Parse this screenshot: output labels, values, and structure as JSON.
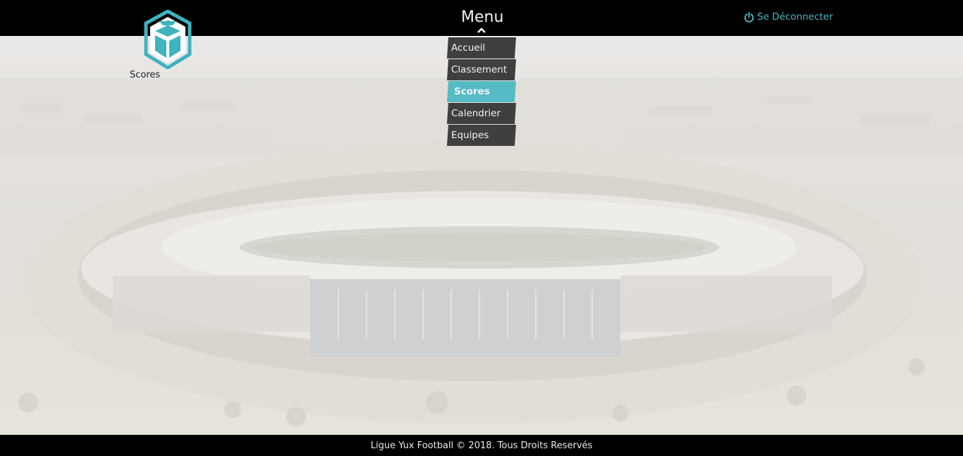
{
  "header": {
    "logo_icon": "cube-logo-icon",
    "logo_caption": "Scores",
    "menu_title": "Menu",
    "menu_caret_icon": "chevron-up-icon",
    "logout_icon": "power-icon",
    "logout_label": "Se Déconnecter"
  },
  "menu": {
    "items": [
      {
        "label": "Accueil",
        "active": false
      },
      {
        "label": "Classement",
        "active": false
      },
      {
        "label": "Scores",
        "active": true
      },
      {
        "label": "Calendrier",
        "active": false
      },
      {
        "label": "Equipes",
        "active": false
      }
    ]
  },
  "footer": {
    "text": "Ligue Yux Football © 2018. Tous Droits Reservés"
  },
  "colors": {
    "accent": "#4fb9c4",
    "active_menu": "#55bcc5",
    "menu_bg": "#3f3f3f",
    "bar_bg": "#000000"
  }
}
